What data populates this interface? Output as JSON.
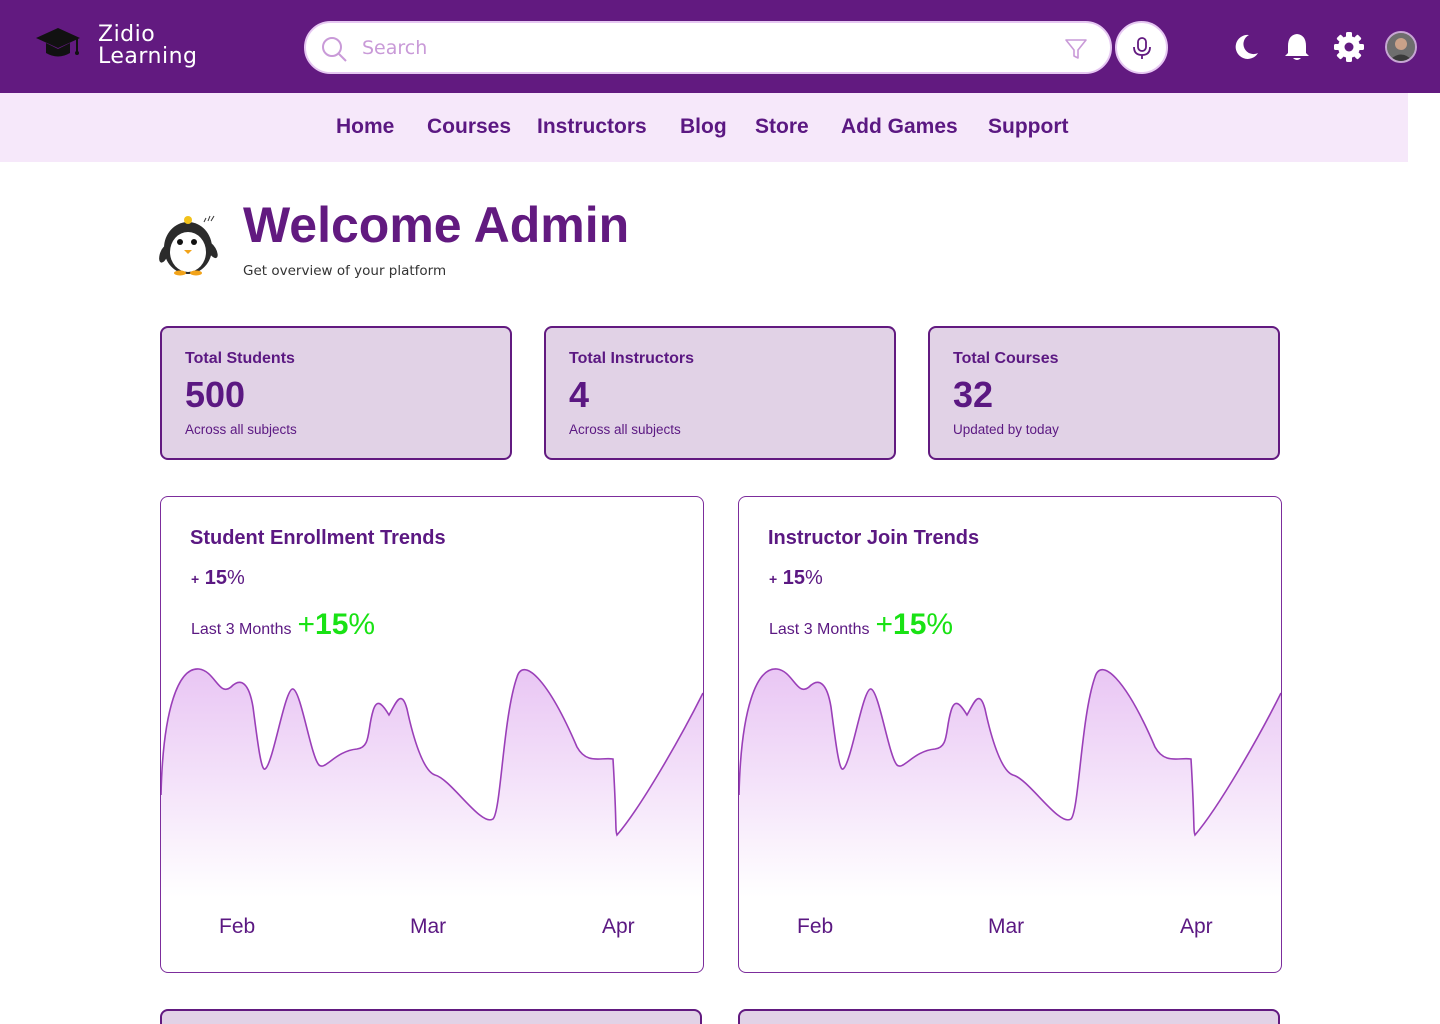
{
  "brand": {
    "line1": "Zidio",
    "line2": "Learning"
  },
  "search": {
    "placeholder": "Search"
  },
  "nav": [
    "Home",
    "Courses",
    "Instructors",
    "Blog",
    "Store",
    "Add Games",
    "Support"
  ],
  "welcome": {
    "title": "Welcome Admin",
    "subtitle": "Get overview of your platform"
  },
  "stats": [
    {
      "label": "Total Students",
      "value": "500",
      "note": "Across all subjects"
    },
    {
      "label": "Total Instructors",
      "value": "4",
      "note": "Across all subjects"
    },
    {
      "label": "Total Courses",
      "value": "32",
      "note": "Updated by today"
    }
  ],
  "charts": [
    {
      "title": "Student Enrollment Trends",
      "delta_sign": "+",
      "delta_value": "15",
      "delta_unit": "%",
      "period": "Last 3 Months",
      "growth_sign": "+",
      "growth_value": "15",
      "growth_unit": "%",
      "months": [
        "Feb",
        "Mar",
        "Apr"
      ]
    },
    {
      "title": "Instructor Join Trends",
      "delta_sign": "+",
      "delta_value": "15",
      "delta_unit": "%",
      "period": "Last 3 Months",
      "growth_sign": "+",
      "growth_value": "15",
      "growth_unit": "%",
      "months": [
        "Feb",
        "Mar",
        "Apr"
      ]
    }
  ],
  "chart_data": [
    {
      "type": "area",
      "title": "Student Enrollment Trends",
      "categories": [
        "Feb",
        "Mar",
        "Apr"
      ]
    },
    {
      "type": "area",
      "title": "Instructor Join Trends",
      "categories": [
        "Feb",
        "Mar",
        "Apr"
      ]
    }
  ],
  "colors": {
    "primary": "#621a80",
    "nav_bg": "#f6e8fa",
    "card_bg": "#e1d2e6",
    "growth": "#19e214"
  },
  "icons": [
    "graduation-cap-icon",
    "search-icon",
    "filter-icon",
    "microphone-icon",
    "moon-icon",
    "bell-icon",
    "gear-icon"
  ]
}
